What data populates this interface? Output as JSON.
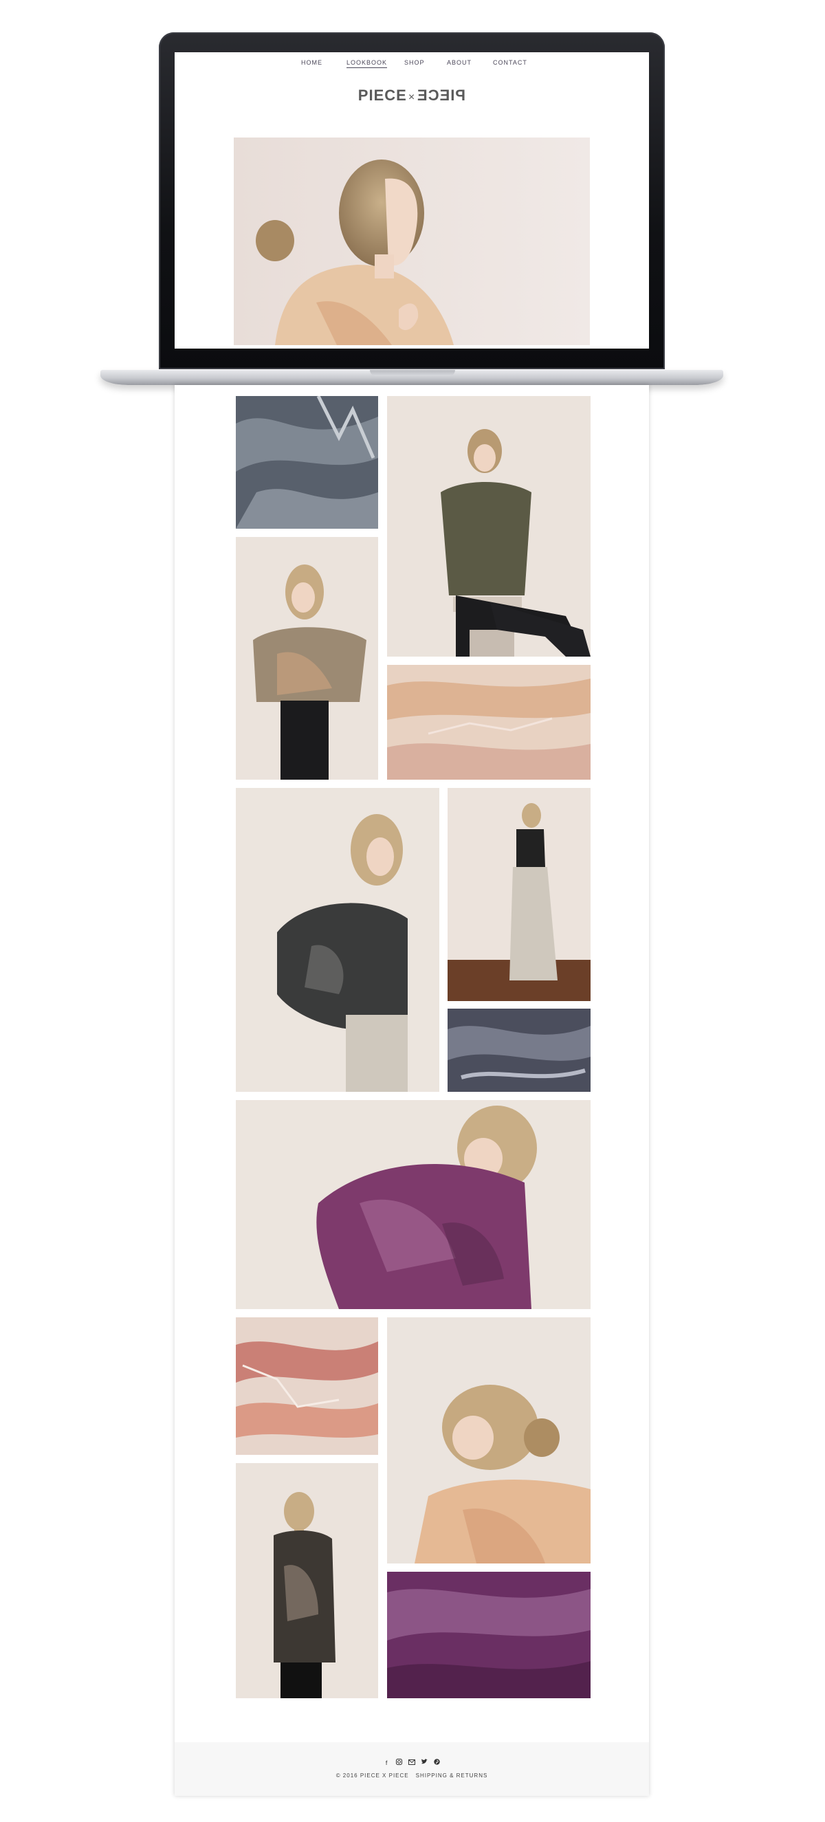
{
  "nav": {
    "items": [
      {
        "label": "HOME"
      },
      {
        "label": "LOOKBOOK"
      },
      {
        "label": "SHOP"
      },
      {
        "label": "ABOUT"
      },
      {
        "label": "CONTACT"
      }
    ],
    "active": "LOOKBOOK"
  },
  "logo": {
    "left": "PIECE",
    "joiner": "×",
    "right": "PIECE"
  },
  "social_icons": [
    "facebook-icon",
    "instagram-icon",
    "email-icon",
    "twitter-icon",
    "pinterest-icon"
  ],
  "footer": {
    "copyright": "© 2016 PIECE X PIECE",
    "link": "SHIPPING & RETURNS"
  },
  "colors": {
    "nav_text": "#4a4658",
    "photo_background": "#ece6e2",
    "footer_background": "#f7f7f7"
  }
}
